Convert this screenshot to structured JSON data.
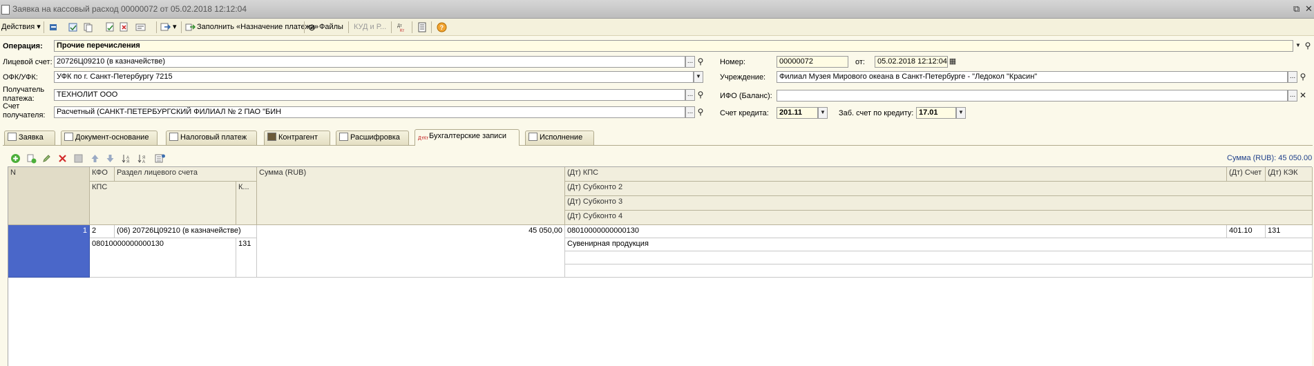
{
  "window": {
    "title": "Заявка на кассовый расход 00000072 от 05.02.2018 12:12:04"
  },
  "toolbar": {
    "actions_label": "Действия",
    "fill_label": "Заполнить «Назначение платежа»",
    "files_label": "Файлы",
    "kud_label": "КУД и Р..."
  },
  "form": {
    "operation_label": "Операция:",
    "operation_value": "Прочие перечисления",
    "account_label": "Лицевой счет:",
    "account_value": "20726Ц09210 (в казначействе)",
    "ofk_label": "ОФК/УФК:",
    "ofk_value": "УФК по г. Санкт-Петербургу 7215",
    "recipient_label_1": "Получатель",
    "recipient_label_2": "платежа:",
    "recipient_value": "ТЕХНОЛИТ ООО",
    "racc_label_1": "Счет",
    "racc_label_2": "получателя:",
    "racc_value": "Расчетный (САНКТ-ПЕТЕРБУРГСКИЙ ФИЛИАЛ № 2 ПАО \"БИН",
    "number_label": "Номер:",
    "number_value": "00000072",
    "date_label": "от:",
    "date_value": "05.02.2018 12:12:04",
    "institution_label": "Учреждение:",
    "institution_value": "Филиал Музея Мирового океана в Санкт-Петербурге - \"Ледокол \"Красин\"",
    "ifo_label": "ИФО (Баланс):",
    "ifo_value": "",
    "credit_label": "Счет кредита:",
    "credit_value": "201.11",
    "offbal_label": "Заб. счет по кредиту:",
    "offbal_value": "17.01"
  },
  "tabs": [
    {
      "label": "Заявка"
    },
    {
      "label": "Документ-основание"
    },
    {
      "label": "Налоговый платеж"
    },
    {
      "label": "Контрагент"
    },
    {
      "label": "Расшифровка"
    },
    {
      "label": "Бухгалтерские записи",
      "active": true
    },
    {
      "label": "Исполнение"
    }
  ],
  "grid": {
    "sum_label": "Сумма (RUB): 45 050.00",
    "headers": {
      "n": "N",
      "kfo": "КФО",
      "section": "Раздел лицевого счета",
      "sum": "Сумма (RUB)",
      "dt_kps": "(Дт) КПС",
      "dt_account": "(Дт) Счет",
      "dt_kek": "(Дт) КЭК",
      "kps": "КПС",
      "k": "К...",
      "sub2": "(Дт) Субконто 2",
      "sub3": "(Дт) Субконто 3",
      "sub4": "(Дт) Субконто 4"
    },
    "row": {
      "n": "1",
      "kfo": "2",
      "section": "(06) 20726Ц09210 (в казначействе)",
      "sum": "45 050,00",
      "dt_kps": "08010000000000130",
      "dt_account": "401.10",
      "dt_kek": "131",
      "kps": "08010000000000130",
      "k": "131",
      "sub2": "Сувенирная продукция",
      "sub3": "",
      "sub4": ""
    }
  }
}
